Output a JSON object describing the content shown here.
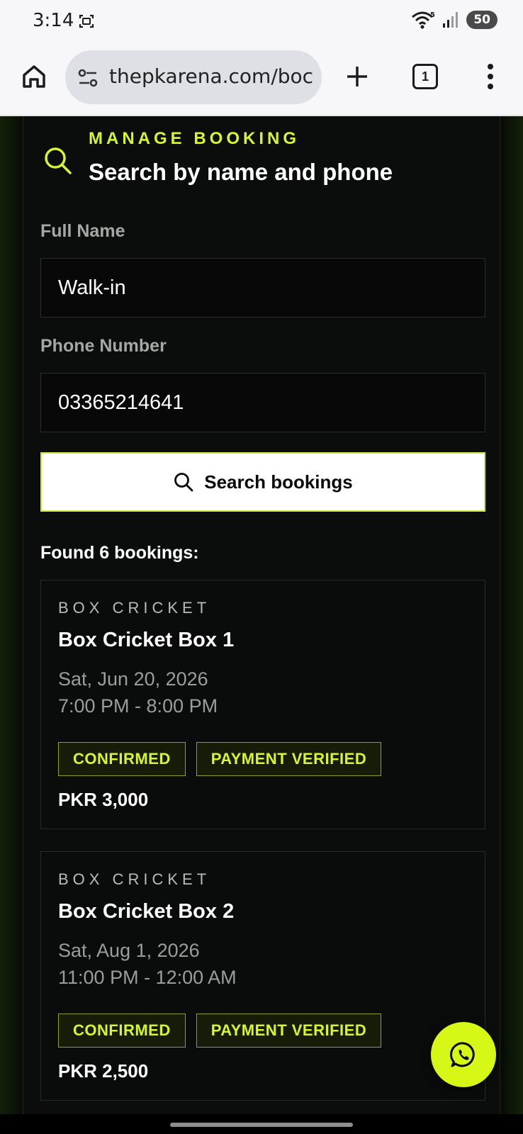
{
  "status_bar": {
    "time": "3:14",
    "battery": "50",
    "network_label": "5"
  },
  "browser": {
    "url": "thepkarena.com/boc",
    "tab_count": "1"
  },
  "section": {
    "eyebrow": "MANAGE BOOKING",
    "heading": "Search by name and phone"
  },
  "form": {
    "name_label": "Full Name",
    "name_value": "Walk-in",
    "phone_label": "Phone Number",
    "phone_value": "03365214641",
    "search_button": "Search bookings"
  },
  "results": {
    "summary": "Found 6 bookings:",
    "bookings": [
      {
        "sport": "BOX CRICKET",
        "title": "Box Cricket Box 1",
        "date": "Sat, Jun 20, 2026",
        "time": "7:00 PM - 8:00 PM",
        "status": "CONFIRMED",
        "payment": "PAYMENT VERIFIED",
        "price": "PKR 3,000"
      },
      {
        "sport": "BOX CRICKET",
        "title": "Box Cricket Box 2",
        "date": "Sat, Aug 1, 2026",
        "time": "11:00 PM - 12:00 AM",
        "status": "CONFIRMED",
        "payment": "PAYMENT VERIFIED",
        "price": "PKR 2,500"
      }
    ]
  },
  "colors": {
    "accent": "#d4f532",
    "background": "#070907",
    "panel": "#0b0d0c",
    "fab": "#d7f716"
  },
  "icons": [
    "screenshot-icon",
    "wifi-icon",
    "signal-icon",
    "home-icon",
    "tune-icon",
    "plus-icon",
    "more-vert-icon",
    "search-icon",
    "whatsapp-icon"
  ]
}
